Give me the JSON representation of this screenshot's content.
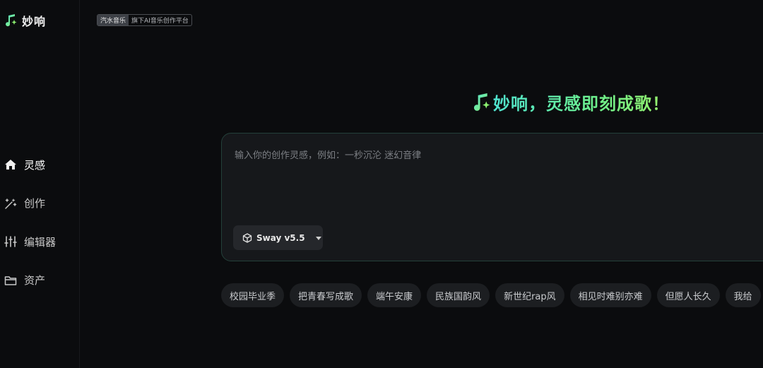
{
  "app": {
    "name": "妙响"
  },
  "badge": {
    "main": "汽水音乐",
    "sub": "旗下AI音乐创作平台"
  },
  "sidebar": {
    "items": [
      {
        "label": "灵感",
        "icon": "home-icon",
        "active": true
      },
      {
        "label": "创作",
        "icon": "magic-wand-icon",
        "active": false
      },
      {
        "label": "编辑器",
        "icon": "sliders-icon",
        "active": false
      },
      {
        "label": "资产",
        "icon": "folder-icon",
        "active": false
      }
    ]
  },
  "hero": {
    "title": "妙响，灵感即刻成歌！"
  },
  "prompt": {
    "placeholder": "输入你的创作灵感，例如：一秒沉沦 迷幻音律",
    "value": ""
  },
  "model": {
    "selected": "Sway v5.5"
  },
  "chips": [
    "校园毕业季",
    "把青春写成歌",
    "端午安康",
    "民族国韵风",
    "新世纪rap风",
    "相见时难别亦难",
    "但愿人长久",
    "我给"
  ],
  "colors": {
    "background": "#0b0c0e",
    "accent_teal": "#4fe3d0",
    "accent_green": "#6ef08a",
    "panel": "#16181b",
    "chip": "#1c1e21"
  }
}
